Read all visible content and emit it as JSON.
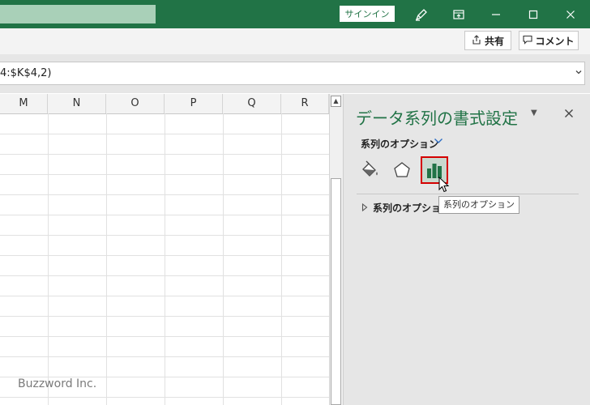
{
  "titlebar": {
    "signin_label": "サインイン"
  },
  "ribbon": {
    "share_label": "共有",
    "comment_label": "コメント"
  },
  "formula_bar": {
    "value": "4:$K$4,2)"
  },
  "grid": {
    "columns": [
      "M",
      "N",
      "O",
      "P",
      "Q",
      "R"
    ]
  },
  "watermark": "Buzzword Inc.",
  "pane": {
    "title": "データ系列の書式設定",
    "subtitle": "系列のオプション",
    "section_label": "系列のオプション",
    "tooltip": "系列のオプション",
    "icons": [
      "fill-line-icon",
      "effects-icon",
      "series-options-icon"
    ]
  },
  "colors": {
    "brand": "#217346",
    "selection": "#d40000"
  }
}
